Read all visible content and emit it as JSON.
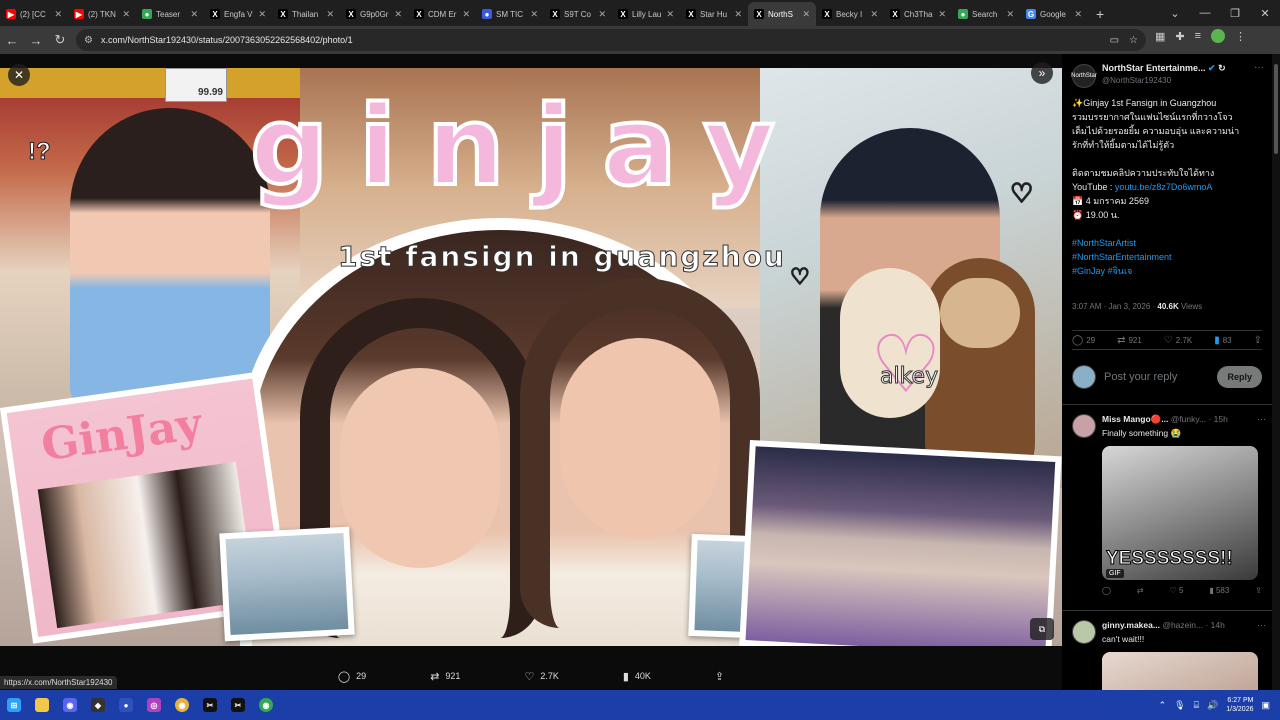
{
  "browser": {
    "tabs": [
      {
        "title": "(2) [CC",
        "icon": "youtube-icon",
        "color": "#ff0000"
      },
      {
        "title": "(2) TKN",
        "icon": "youtube-icon",
        "color": "#ff0000"
      },
      {
        "title": "Teaser",
        "icon": "chrome-icon",
        "color": "#34a853"
      },
      {
        "title": "Engfa V",
        "icon": "x-icon",
        "color": "#000000"
      },
      {
        "title": "Thailan",
        "icon": "x-icon",
        "color": "#000000"
      },
      {
        "title": "G9p0Gr",
        "icon": "x-icon",
        "color": "#000000"
      },
      {
        "title": "CDM Er",
        "icon": "x-icon",
        "color": "#000000"
      },
      {
        "title": "SM TIC",
        "icon": "globe-icon",
        "color": "#3b5bdb"
      },
      {
        "title": "S9T Co",
        "icon": "x-icon",
        "color": "#000000"
      },
      {
        "title": "Lilly Lau",
        "icon": "x-icon",
        "color": "#000000"
      },
      {
        "title": "Star Hu",
        "icon": "x-icon",
        "color": "#000000"
      },
      {
        "title": "NorthS",
        "icon": "x-icon",
        "color": "#000000",
        "active": true
      },
      {
        "title": "Becky I",
        "icon": "x-icon",
        "color": "#000000"
      },
      {
        "title": "Ch3Tha",
        "icon": "x-icon",
        "color": "#000000"
      },
      {
        "title": "Search",
        "icon": "chrome-icon",
        "color": "#34a853"
      },
      {
        "title": "Google",
        "icon": "google-icon",
        "color": "#4285f4"
      }
    ],
    "url": "x.com/NorthStar192430/status/2007363052262568402/photo/1",
    "status_url": "https://x.com/NorthStar192430"
  },
  "photo": {
    "title_text": "ginjay",
    "subtitle_text": "1st fansign in guangzhou",
    "alkey_text": "alkey",
    "magazine_text": "GinJay",
    "price_tag": "99.99",
    "doodle_exclaim": "!?"
  },
  "viewer_actions": {
    "replies": "29",
    "reposts": "921",
    "likes": "2.7K",
    "views": "40K"
  },
  "tweet": {
    "author_name": "NorthStar Entertainme...",
    "author_handle": "@NorthStar192430",
    "avatar_text": "NorthStar",
    "lines": [
      "✨Ginjay 1st Fansign in Guangzhou",
      "รวมบรรยากาศในแฟนไซน์แรกที่กวางโจว",
      "เต็มไปด้วยรอยยิ้ม ความอบอุ่น และความน่า",
      "รักที่ทำให้ยิ้มตามได้ไม่รู้ตัว"
    ],
    "youtube_prefix": "ติดตามชมคลิปความประทับใจได้ทาง",
    "youtube_label": "YouTube : ",
    "youtube_link": "youtu.be/z8z7Do6wmoA",
    "date_line": "📅 4 มกราคม 2569",
    "time_line": "⏰ 19.00 น.",
    "hashtags": [
      "#NorthStarArtist",
      "#NorthStarEntertainment",
      "#GinJay #จินเจ"
    ],
    "timestamp": "3:07 AM · Jan 3, 2026 · ",
    "views_count": "40.6K",
    "views_label": " Views",
    "stats": {
      "replies": "29",
      "reposts": "921",
      "likes": "2.7K",
      "bookmarks": "83"
    },
    "reply_placeholder": "Post your reply",
    "reply_button": "Reply"
  },
  "replies": [
    {
      "name": "Miss Mango🔴...",
      "handle": "@funky...",
      "time": "· 15h",
      "text": "Finally something 😭",
      "media_caption": "YESSSSSSS!!",
      "media_badge": "GIF",
      "actions": {
        "replies": "",
        "reposts": "",
        "likes": "5",
        "views": "583"
      }
    },
    {
      "name": "ginny.makea...",
      "handle": "@hazein...",
      "time": "· 14h",
      "text": "can't wait!!!"
    }
  ],
  "taskbar": {
    "time": "6:27 PM",
    "date": "1/3/2026"
  }
}
